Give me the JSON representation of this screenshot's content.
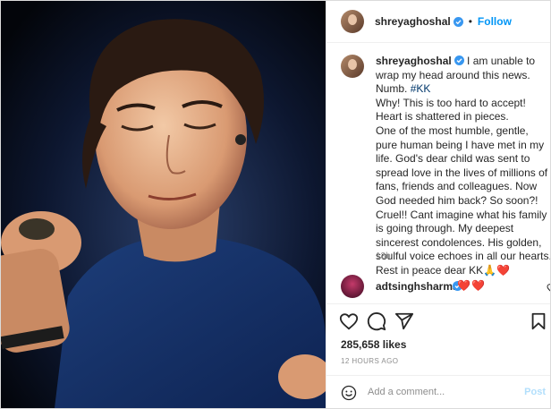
{
  "post": {
    "author": "shreyaghoshal",
    "follow_label": "Follow",
    "separator": "•",
    "caption": {
      "username": "shreyaghoshal",
      "text_before_tag": "I am unable to wrap my head around this news. Numb. ",
      "hashtag": "#KK",
      "text_after_tag": "\nWhy! This is too hard to accept! Heart is shattered in pieces.\nOne of the most humble, gentle, pure human being I have met in my life. God's dear child was sent to spread love in the lives of millions of fans, friends and colleagues. Now God needed him back? So soon?! Cruel!! Cant imagine what his family is going through. My deepest sincerest condolences. His golden, soulful voice echoes in all our hearts. Rest in peace dear KK🙏❤️",
      "time_ago": "13h"
    },
    "comment": {
      "username": "adtsinghsharma",
      "text": "❤️❤️"
    },
    "likes": "285,658 likes",
    "posted_ago": "12 HOURS AGO",
    "add_comment_placeholder": "Add a comment...",
    "post_label": "Post"
  },
  "colors": {
    "link_blue": "#0095f6",
    "verified_blue": "#3897f0",
    "heart_red": "#ed4956",
    "muted_gray": "#8e8e8e",
    "post_disabled": "#b2dffc"
  },
  "icons": [
    "like-icon",
    "comment-icon",
    "share-icon",
    "save-icon",
    "emoji-icon",
    "verified-icon",
    "comment-like-icon"
  ]
}
